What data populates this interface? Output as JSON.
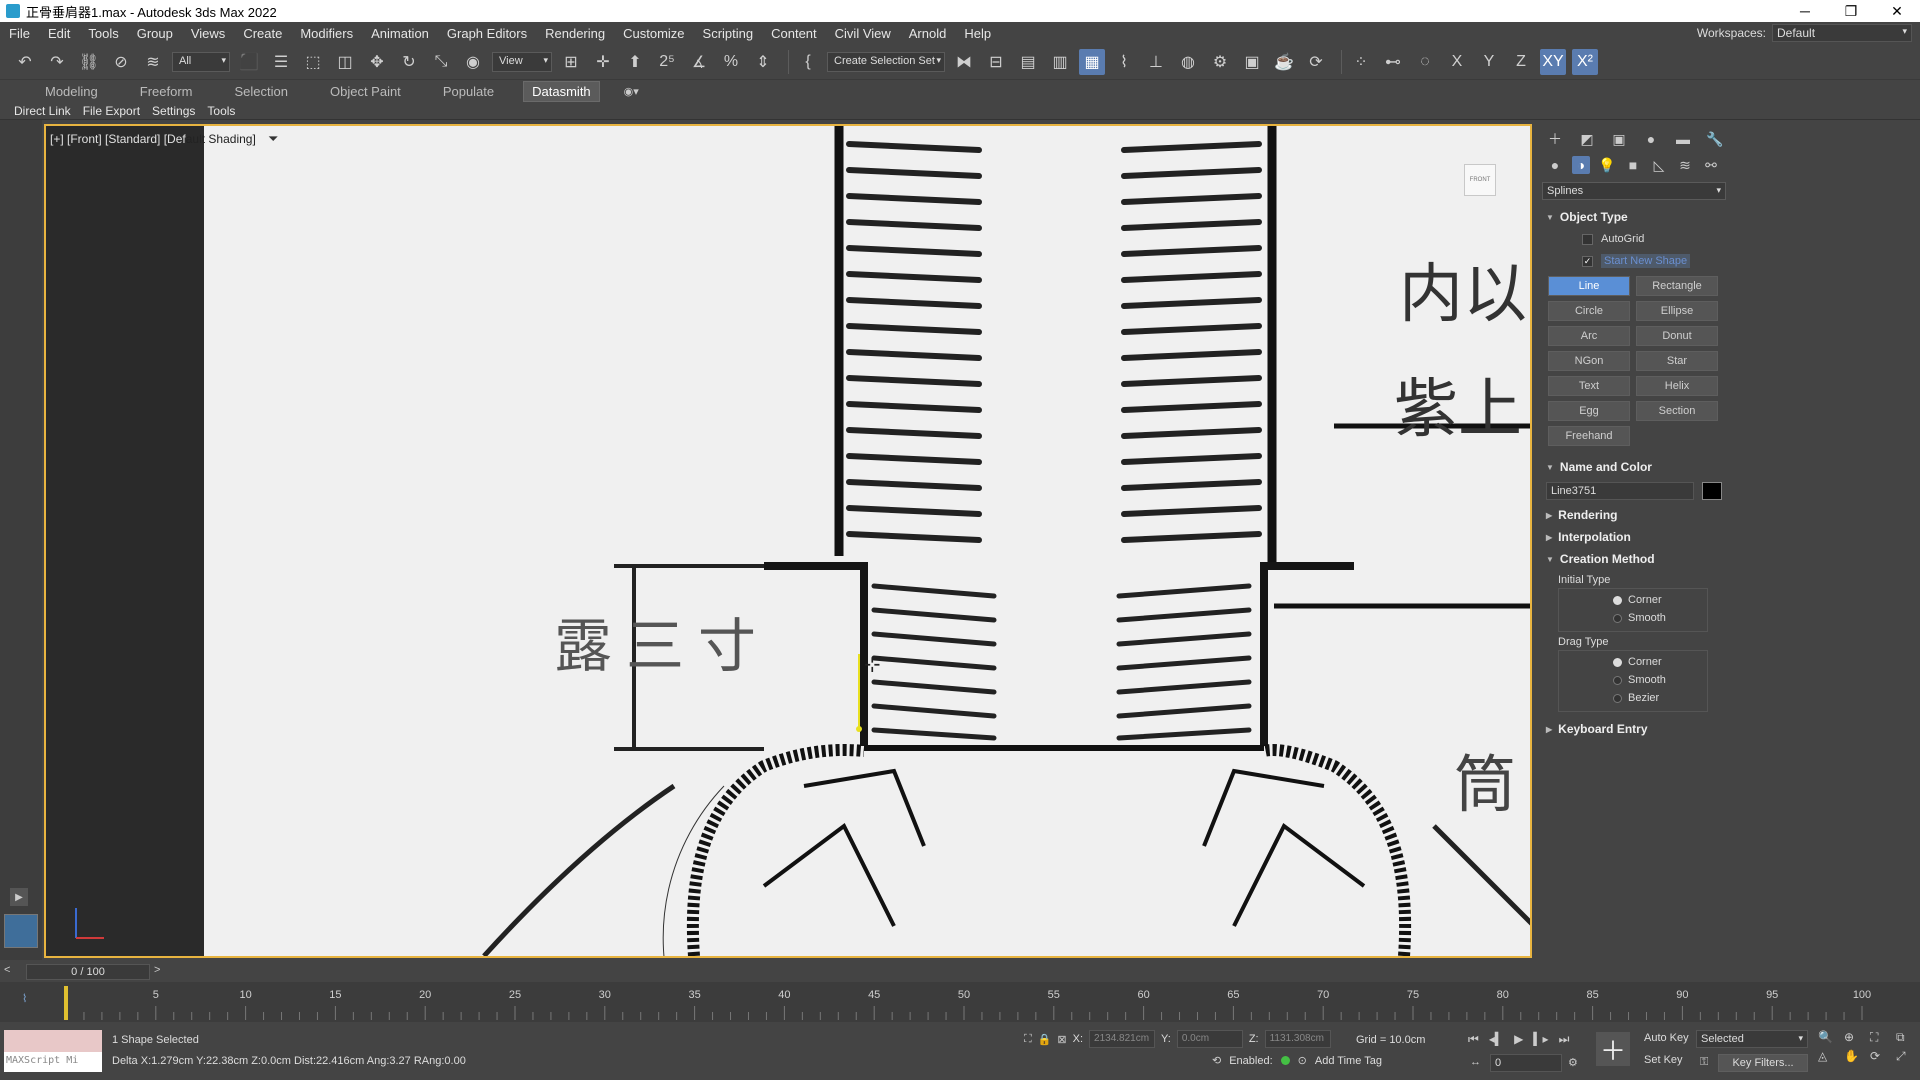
{
  "window": {
    "title": "正骨垂肩器1.max - Autodesk 3ds Max 2022",
    "controls": [
      "─",
      "❐",
      "✕"
    ]
  },
  "menu": {
    "items": [
      "File",
      "Edit",
      "Tools",
      "Group",
      "Views",
      "Create",
      "Modifiers",
      "Animation",
      "Graph Editors",
      "Rendering",
      "Customize",
      "Scripting",
      "Content",
      "Civil View",
      "Arnold",
      "Help"
    ],
    "workspaces_label": "Workspaces:",
    "workspaces_value": "Default"
  },
  "toolbar": {
    "filter_value": "All",
    "view_value": "View",
    "selection_set_placeholder": "Create Selection Set",
    "axis_x": "X",
    "axis_y": "Y",
    "axis_z": "Z",
    "axis_xy": "XY"
  },
  "ribbon": {
    "tabs": [
      "Modeling",
      "Freeform",
      "Selection",
      "Object Paint",
      "Populate"
    ],
    "active_tab": "Datasmith",
    "subitems": [
      "Direct Link",
      "File Export",
      "Settings",
      "Tools"
    ]
  },
  "viewport": {
    "label_prefix": "[+] [Front] [Standard] [Def",
    "label_rest": "ault Shading]",
    "viewcube_label": "FRONT",
    "drawing_text_left": "露三寸",
    "drawing_text_right_1": "内以",
    "drawing_text_right_2": "紫上",
    "drawing_text_right_3": "筒"
  },
  "command_panel": {
    "category": "Splines",
    "object_type": {
      "title": "Object Type",
      "autogrid_label": "AutoGrid",
      "start_new_shape_label": "Start New Shape",
      "buttons": [
        "Line",
        "Rectangle",
        "Circle",
        "Ellipse",
        "Arc",
        "Donut",
        "NGon",
        "Star",
        "Text",
        "Helix",
        "Egg",
        "Section",
        "Freehand"
      ],
      "active_button": "Line"
    },
    "name_and_color": {
      "title": "Name and Color",
      "name_value": "Line3751",
      "color": "#000000"
    },
    "rendering_title": "Rendering",
    "interpolation_title": "Interpolation",
    "creation_method": {
      "title": "Creation Method",
      "initial_type_label": "Initial Type",
      "initial_options": [
        "Corner",
        "Smooth"
      ],
      "initial_selected": "Corner",
      "drag_type_label": "Drag Type",
      "drag_options": [
        "Corner",
        "Smooth",
        "Bezier"
      ],
      "drag_selected": "Corner"
    },
    "keyboard_entry_title": "Keyboard Entry"
  },
  "timeline": {
    "frame_display": "0 / 100",
    "current_frame": 0,
    "start": 0,
    "end": 100,
    "tick_labels": [
      "5",
      "10",
      "15",
      "20",
      "25",
      "30",
      "35",
      "40",
      "45",
      "50",
      "55",
      "60",
      "65",
      "70",
      "75",
      "80",
      "85",
      "90",
      "95",
      "100"
    ]
  },
  "status": {
    "maxscript_label": "MAXScript Mi",
    "selection_text": "1 Shape Selected",
    "prompt_text": "Delta X:1.279cm  Y:22.38cm  Z:0.0cm  Dist:22.416cm  Ang:3.27 RAng:0.00",
    "x_label": "X:",
    "x_value": "2134.821cm",
    "y_label": "Y:",
    "y_value": "0.0cm",
    "z_label": "Z:",
    "z_value": "1131.308cm",
    "grid_text": "Grid = 10.0cm",
    "enabled_label": "Enabled:",
    "add_time_tag": "Add Time Tag",
    "auto_key": "Auto Key",
    "set_key": "Set Key",
    "selected_value": "Selected",
    "key_filters": "Key Filters...",
    "frame_field_value": "0"
  },
  "colors": {
    "accent": "#5a8fd6",
    "viewport_border": "#e8b440",
    "ui_bg": "#444444"
  }
}
